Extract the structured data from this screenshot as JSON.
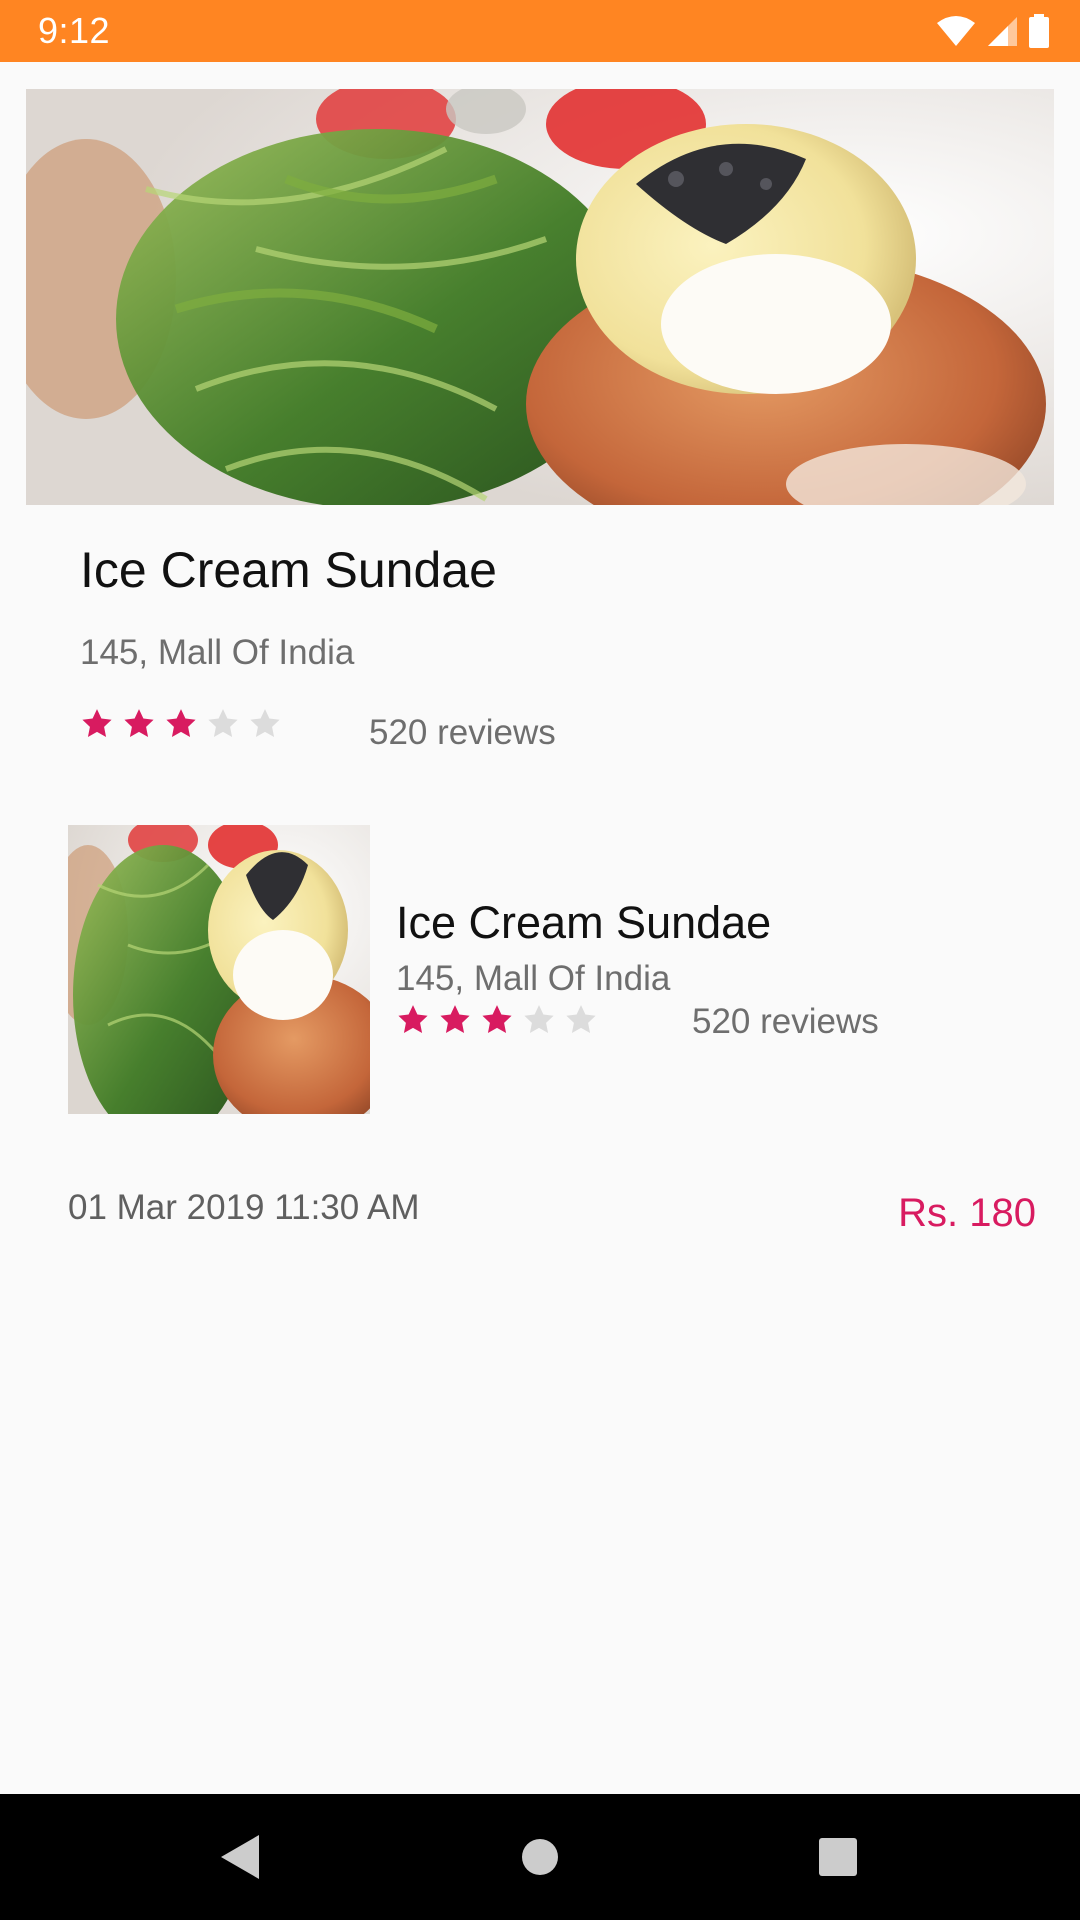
{
  "status_bar": {
    "time": "9:12",
    "icons": [
      "wifi-icon",
      "cell-signal-icon",
      "battery-icon"
    ],
    "background": "#ff8522"
  },
  "hero": {
    "title": "Ice Cream Sundae",
    "address": "145, Mall Of India",
    "rating": 3,
    "rating_max": 5,
    "reviews": "520 reviews"
  },
  "card": {
    "title": "Ice Cream Sundae",
    "address": "145, Mall Of India",
    "rating": 3,
    "rating_max": 5,
    "reviews": "520 reviews"
  },
  "order": {
    "date": "01 Mar 2019 11:30 AM",
    "price": "Rs. 180"
  },
  "nav_bar": {
    "buttons": [
      "back-icon",
      "home-icon",
      "recents-icon"
    ]
  },
  "colors": {
    "accent": "#d81b60",
    "star_empty": "#dcdcdc",
    "text_primary": "#111111",
    "text_secondary": "#6e6e6e"
  }
}
